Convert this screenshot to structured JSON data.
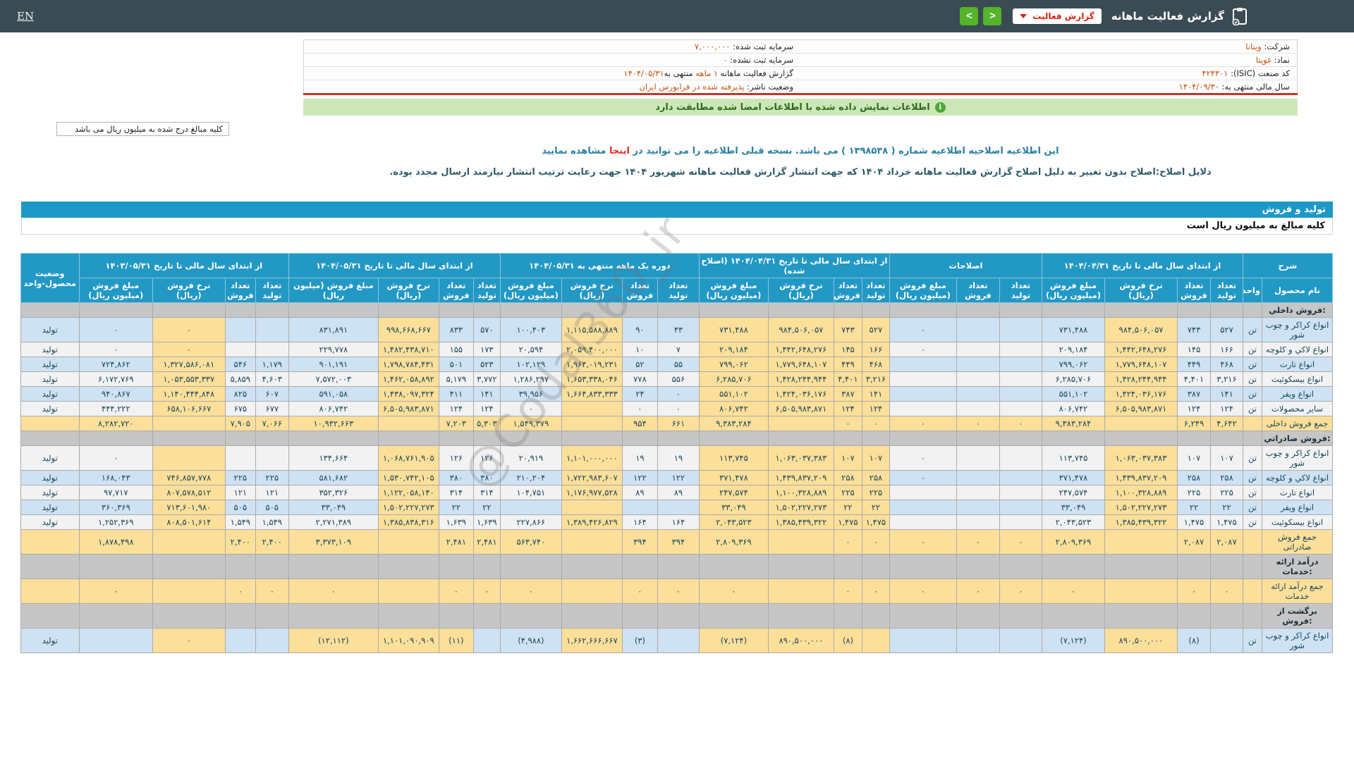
{
  "navbar": {
    "en_label": "EN",
    "title": "گزارش فعالیت ماهانه",
    "dropdown_label": "گزارش فعالیت",
    "back_glyph": "<",
    "forward_glyph": ">"
  },
  "info": {
    "rows": [
      {
        "right": {
          "label": "شرکت:",
          "value": "ویتانا"
        },
        "left": {
          "label": "سرمایه ثبت شده:",
          "value": "۷,۰۰۰,۰۰۰"
        }
      },
      {
        "right": {
          "label": "نماد:",
          "value": "غویتا"
        },
        "left": {
          "label": "سرمایه ثبت نشده:",
          "value": "۰"
        }
      },
      {
        "right": {
          "label": "کد صنعت (ISIC):",
          "value": "۴۲۴۳۰۱"
        },
        "left": {
          "label": "گزارش فعالیت ماهانه",
          "value": "۱ ماهه",
          "label2": "منتهی به",
          "value2": "۱۴۰۴/۰۵/۳۱"
        }
      },
      {
        "right": {
          "label": "سال مالی منتهی به:",
          "value": "۱۴۰۴/۰۹/۳۰"
        },
        "left": {
          "label": "وضعیت ناشر:",
          "value": "پذیرفته شده در فرابورس ایران"
        }
      }
    ]
  },
  "notice": "اطلاعات نمایش داده شده با اطلاعات امضا شده مطابقت دارد",
  "unit_note": "کلیه مبالغ درج شده به میلیون ریال می باشد",
  "amendment": {
    "line1_prefix": "این اطلاعیه اصلاحیه اطلاعیه شماره ( ۱۳۹۸۵۳۸ ) می باشد. نسخه قبلی اطلاعیه را می توانید در ",
    "line1_link": "اینجا",
    "line1_suffix": " مشاهده نمایید",
    "line2": "دلایل اصلاح:اصلاح بدون تغییر به دلیل اصلاح گزارش فعالیت ماهانه خرداد ۱۴۰۴ که جهت انتشار گزارش فعالیت ماهانه شهریور ۱۴۰۴ جهت رعایت ترتیب انتشار نیازمند ارسال مجدد بوده."
  },
  "section_title": "تولید و فروش",
  "table_note": "کلیه مبالغ به میلیون ریال است",
  "watermark": "@Codal360_ir",
  "table": {
    "groups": [
      {
        "title": "شرح",
        "cols": [
          "نام محصول",
          "واحد"
        ]
      },
      {
        "title": "از ابتدای سال مالی تا تاریخ ۱۴۰۴/۰۴/۳۱",
        "cols": [
          "تعداد تولید",
          "تعداد فروش",
          "نرخ فروش (ریال)",
          "مبلغ فروش (میلیون ریال)"
        ]
      },
      {
        "title": "اصلاحات",
        "cols": [
          "تعداد تولید",
          "تعداد فروش",
          "مبلغ فروش (میلیون ریال)"
        ]
      },
      {
        "title": "از ابتدای سال مالی تا تاریخ ۱۴۰۴/۰۴/۳۱ (اصلاح شده)",
        "cols": [
          "تعداد تولید",
          "تعداد فروش",
          "نرخ فروش (ریال)",
          "مبلغ فروش (میلیون ریال)"
        ]
      },
      {
        "title": "دوره یک ماهه منتهی به ۱۴۰۴/۰۵/۳۱",
        "cols": [
          "تعداد تولید",
          "تعداد فروش",
          "نرخ فروش (ریال)",
          "مبلغ فروش (میلیون ریال)"
        ]
      },
      {
        "title": "از ابتدای سال مالی تا تاریخ ۱۴۰۴/۰۵/۳۱",
        "cols": [
          "تعداد تولید",
          "تعداد فروش",
          "نرخ فروش (ریال)",
          "مبلغ فروش (میلیون ریال)"
        ]
      },
      {
        "title": "از ابتدای سال مالی تا تاریخ ۱۴۰۳/۰۵/۳۱",
        "cols": [
          "تعداد تولید",
          "تعداد فروش",
          "نرخ فروش (ریال)",
          "مبلغ فروش (میلیون ریال)"
        ]
      },
      {
        "title": "وضعیت محصول-واحد",
        "cols": []
      }
    ],
    "rows": [
      {
        "type": "section",
        "cells": [
          "فروش داخلي:",
          "",
          "",
          "",
          "",
          "",
          "",
          "",
          "",
          "",
          "",
          "",
          "",
          "",
          "",
          "",
          "",
          "",
          "",
          "",
          "",
          "",
          "",
          "",
          "",
          ""
        ]
      },
      {
        "type": "data",
        "shade": "b",
        "cells": [
          "انواع کراکر و چوب شور",
          "تن",
          "۵۲۷",
          "۷۴۳",
          "۹۸۴,۵۰۶,۰۵۷",
          "۷۳۱,۴۸۸",
          "",
          "",
          "۰",
          "۵۲۷",
          "۷۴۳",
          "۹۸۴,۵۰۶,۰۵۷",
          "۷۳۱,۴۸۸",
          "۴۳",
          "۹۰",
          "۱,۱۱۵,۵۸۸,۸۸۹",
          "۱۰۰,۴۰۳",
          "۵۷۰",
          "۸۳۳",
          "۹۹۸,۶۶۸,۶۶۷",
          "۸۳۱,۸۹۱",
          "",
          "",
          "۰",
          "۰",
          "تولید"
        ]
      },
      {
        "type": "data",
        "shade": "w",
        "cells": [
          "انواع لاکي و کلوچه",
          "تن",
          "۱۶۶",
          "۱۴۵",
          "۱,۴۴۲,۶۴۸,۲۷۶",
          "۲۰۹,۱۸۴",
          "",
          "",
          "۰",
          "۱۶۶",
          "۱۴۵",
          "۱,۴۴۲,۶۴۸,۲۷۶",
          "۲۰۹,۱۸۴",
          "۷",
          "۱۰",
          "۲,۰۵۹,۴۰۰,۰۰۰",
          "۲۰,۵۹۴",
          "۱۷۳",
          "۱۵۵",
          "۱,۴۸۲,۴۳۸,۷۱۰",
          "۲۲۹,۷۷۸",
          "",
          "",
          "۰",
          "۰",
          "تولید"
        ]
      },
      {
        "type": "data",
        "shade": "b",
        "cells": [
          "انواع تارت",
          "تن",
          "۴۶۸",
          "۴۴۹",
          "۱,۷۷۹,۶۴۸,۱۰۷",
          "۷۹۹,۰۶۲",
          "",
          "",
          "",
          "۴۶۸",
          "۴۴۹",
          "۱,۷۷۹,۶۴۸,۱۰۷",
          "۷۹۹,۰۶۲",
          "۵۵",
          "۵۲",
          "۱,۹۶۴,۰۱۹,۲۳۱",
          "۱۰۲,۱۲۹",
          "۵۲۳",
          "۵۰۱",
          "۱,۷۹۸,۷۸۴,۴۳۱",
          "۹۰۱,۱۹۱",
          "۱,۱۷۹",
          "۵۴۶",
          "۱,۳۲۷,۵۸۶,۰۸۱",
          "۷۲۴,۸۶۲",
          "تولید"
        ]
      },
      {
        "type": "data",
        "shade": "w",
        "cells": [
          "انواع بیسکوئیت",
          "تن",
          "۳,۲۱۶",
          "۴,۴۰۱",
          "۱,۴۲۸,۲۴۴,۹۴۴",
          "۶,۲۸۵,۷۰۶",
          "",
          "",
          "",
          "۳,۲۱۶",
          "۴,۴۰۱",
          "۱,۴۲۸,۲۴۴,۹۴۴",
          "۶,۲۸۵,۷۰۶",
          "۵۵۶",
          "۷۷۸",
          "۱,۶۵۳,۳۳۸,۰۴۶",
          "۱,۲۸۶,۲۹۷",
          "۳,۷۷۲",
          "۵,۱۷۹",
          "۱,۴۶۲,۰۵۸,۸۹۲",
          "۷,۵۷۲,۰۰۳",
          "۴,۶۰۳",
          "۵,۸۵۹",
          "۱,۰۵۳,۵۵۳,۳۳۷",
          "۶,۱۷۲,۷۶۹",
          "تولید"
        ]
      },
      {
        "type": "data",
        "shade": "b",
        "cells": [
          "انواع ویفر",
          "تن",
          "۱۴۱",
          "۳۸۷",
          "۱,۴۲۴,۰۳۶,۱۷۶",
          "۵۵۱,۱۰۲",
          "",
          "",
          "",
          "۱۴۱",
          "۳۸۷",
          "۱,۴۲۴,۰۳۶,۱۷۶",
          "۵۵۱,۱۰۲",
          "۰",
          "۲۴",
          "۱,۶۶۴,۸۳۳,۳۳۳",
          "۳۹,۹۵۶",
          "۱۴۱",
          "۴۱۱",
          "۱,۴۳۸,۰۹۷,۳۲۴",
          "۵۹۱,۰۵۸",
          "۶۰۷",
          "۸۲۵",
          "۱,۱۴۰,۴۴۴,۸۴۸",
          "۹۴۰,۸۶۷",
          "تولید"
        ]
      },
      {
        "type": "data",
        "shade": "w",
        "cells": [
          "سایر محصولات",
          "تن",
          "۱۲۴",
          "۱۲۴",
          "۶,۵۰۵,۹۸۳,۸۷۱",
          "۸۰۶,۷۴۲",
          "",
          "",
          "",
          "۱۲۴",
          "۱۲۴",
          "۶,۵۰۵,۹۸۳,۸۷۱",
          "۸۰۶,۷۴۲",
          "۰",
          "۰",
          "",
          "۰",
          "۱۲۴",
          "۱۲۴",
          "۶,۵۰۵,۹۸۳,۸۷۱",
          "۸۰۶,۷۴۲",
          "۶۷۷",
          "۶۷۵",
          "۶۵۸,۱۰۶,۶۶۷",
          "۴۴۴,۲۲۲",
          "تولید"
        ]
      },
      {
        "type": "total",
        "cells": [
          "جمع فروش داخلی",
          "",
          "۴,۶۴۲",
          "۶,۲۴۹",
          "",
          "۹,۳۸۳,۲۸۴",
          "۰",
          "۰",
          "۰",
          "۰",
          "۰",
          "",
          "۹,۳۸۳,۲۸۴",
          "۶۶۱",
          "۹۵۴",
          "",
          "۱,۵۴۹,۳۷۹",
          "۵,۳۰۳",
          "۷,۲۰۳",
          "",
          "۱۰,۹۳۲,۶۶۳",
          "۷,۰۶۶",
          "۷,۹۰۵",
          "",
          "۸,۲۸۲,۷۲۰",
          ""
        ]
      },
      {
        "type": "section",
        "cells": [
          "فروش صادراتي:",
          "",
          "",
          "",
          "",
          "",
          "",
          "",
          "",
          "",
          "",
          "",
          "",
          "",
          "",
          "",
          "",
          "",
          "",
          "",
          "",
          "",
          "",
          "",
          "",
          ""
        ]
      },
      {
        "type": "data",
        "shade": "w",
        "cells": [
          "انواع کراکر و چوب شور",
          "تن",
          "۱۰۷",
          "۱۰۷",
          "۱,۰۶۳,۰۳۷,۳۸۳",
          "۱۱۳,۷۴۵",
          "",
          "",
          "۰",
          "۱۰۷",
          "۱۰۷",
          "۱,۰۶۳,۰۳۷,۳۸۳",
          "۱۱۳,۷۴۵",
          "۱۹",
          "۱۹",
          "۱,۱۰۱,۰۰۰,۰۰۰",
          "۲۰,۹۱۹",
          "۱۲۶",
          "۱۲۶",
          "۱,۰۶۸,۷۶۱,۹۰۵",
          "۱۳۴,۶۶۴",
          "",
          "",
          "",
          "۰",
          "تولید"
        ]
      },
      {
        "type": "data",
        "shade": "b",
        "cells": [
          "انواع لاکي و کلوچه",
          "تن",
          "۲۵۸",
          "۲۵۸",
          "۱,۴۳۹,۸۳۷,۲۰۹",
          "۳۷۱,۴۷۸",
          "",
          "",
          "۰",
          "۲۵۸",
          "۲۵۸",
          "۱,۴۳۹,۸۳۷,۲۰۹",
          "۳۷۱,۴۷۸",
          "۱۲۲",
          "۱۲۲",
          "۱,۷۲۲,۹۸۳,۶۰۷",
          "۲۱۰,۲۰۴",
          "۳۸۰",
          "۳۸۰",
          "۱,۵۳۰,۷۴۲,۱۰۵",
          "۵۸۱,۶۸۲",
          "۲۲۵",
          "۲۲۵",
          "۷۴۶,۸۵۷,۷۷۸",
          "۱۶۸,۰۴۳",
          "تولید"
        ]
      },
      {
        "type": "data",
        "shade": "w",
        "cells": [
          "انواع تارت",
          "تن",
          "۲۲۵",
          "۲۲۵",
          "۱,۱۰۰,۳۲۸,۸۸۹",
          "۲۴۷,۵۷۴",
          "",
          "",
          "",
          "۲۲۵",
          "۲۲۵",
          "۱,۱۰۰,۳۲۸,۸۸۹",
          "۲۴۷,۵۷۴",
          "۸۹",
          "۸۹",
          "۱,۱۷۶,۹۷۷,۵۲۸",
          "۱۰۴,۷۵۱",
          "۳۱۴",
          "۳۱۴",
          "۱,۱۲۲,۰۵۸,۱۴۰",
          "۳۵۲,۳۲۶",
          "۱۲۱",
          "۱۲۱",
          "۸۰۷,۵۷۸,۵۱۲",
          "۹۷,۷۱۷",
          "تولید"
        ]
      },
      {
        "type": "data",
        "shade": "b",
        "cells": [
          "انواع ویفر",
          "تن",
          "۲۲",
          "۲۲",
          "۱,۵۰۲,۲۲۷,۲۷۳",
          "۳۳,۰۴۹",
          "",
          "",
          "",
          "۲۲",
          "۲۲",
          "۱,۵۰۲,۲۲۷,۲۷۳",
          "۳۳,۰۴۹",
          "",
          "",
          "",
          "",
          "۲۲",
          "۲۲",
          "۱,۵۰۲,۲۲۷,۲۷۳",
          "۳۳,۰۴۹",
          "۵۰۵",
          "۵۰۵",
          "۷۱۳,۶۰۱,۹۸۰",
          "۳۶۰,۳۶۹",
          "تولید"
        ]
      },
      {
        "type": "data",
        "shade": "w",
        "cells": [
          "انواع بیسکوئیت",
          "تن",
          "۱,۴۷۵",
          "۱,۴۷۵",
          "۱,۳۸۵,۴۳۹,۳۲۲",
          "۲,۰۴۳,۵۲۳",
          "",
          "",
          "",
          "۱,۴۷۵",
          "۱,۴۷۵",
          "۱,۳۸۵,۴۳۹,۳۲۲",
          "۲,۰۴۳,۵۲۳",
          "۱۶۴",
          "۱۶۴",
          "۱,۳۸۹,۴۲۶,۸۲۹",
          "۲۲۷,۸۶۶",
          "۱,۶۳۹",
          "۱,۶۳۹",
          "۱,۳۸۵,۸۳۸,۳۱۶",
          "۲,۲۷۱,۳۸۹",
          "۱,۵۴۹",
          "۱,۵۴۹",
          "۸۰۸,۵۰۱,۶۱۴",
          "۱,۲۵۲,۳۶۹",
          "تولید"
        ]
      },
      {
        "type": "total",
        "cells": [
          "جمع فروش صادراتی",
          "",
          "۲,۰۸۷",
          "۲,۰۸۷",
          "",
          "۲,۸۰۹,۳۶۹",
          "۰",
          "۰",
          "۰",
          "۰",
          "۰",
          "",
          "۲,۸۰۹,۳۶۹",
          "۳۹۴",
          "۳۹۴",
          "",
          "۵۶۳,۷۴۰",
          "۲,۴۸۱",
          "۲,۴۸۱",
          "",
          "۳,۳۷۳,۱۰۹",
          "۲,۴۰۰",
          "۲,۴۰۰",
          "",
          "۱,۸۷۸,۴۹۸",
          ""
        ]
      },
      {
        "type": "section",
        "cells": [
          "درآمد ارائه خدمات:",
          "",
          "",
          "",
          "",
          "",
          "",
          "",
          "",
          "",
          "",
          "",
          "",
          "",
          "",
          "",
          "",
          "",
          "",
          "",
          "",
          "",
          "",
          "",
          "",
          ""
        ]
      },
      {
        "type": "total",
        "cells": [
          "جمع درآمد ارائه خدمات",
          "",
          "۰",
          "۰",
          "",
          "۰",
          "۰",
          "۰",
          "۰",
          "۰",
          "۰",
          "",
          "۰",
          "۰",
          "۰",
          "",
          "۰",
          "۰",
          "۰",
          "",
          "۰",
          "۰",
          "۰",
          "",
          "۰",
          ""
        ]
      },
      {
        "type": "section",
        "cells": [
          "برگشت از فروش:",
          "",
          "",
          "",
          "",
          "",
          "",
          "",
          "",
          "",
          "",
          "",
          "",
          "",
          "",
          "",
          "",
          "",
          "",
          "",
          "",
          "",
          "",
          "",
          "",
          ""
        ]
      },
      {
        "type": "data",
        "shade": "b",
        "neg": [
          3,
          5,
          10,
          12,
          14,
          16,
          18,
          20
        ],
        "yl": [
          18,
          20
        ],
        "cells": [
          "انواع کراکر و چوب شور",
          "تن",
          "",
          "(۸)",
          "۸۹۰,۵۰۰,۰۰۰",
          "(۷,۱۲۴)",
          "",
          "",
          "",
          "",
          "(۸)",
          "۸۹۰,۵۰۰,۰۰۰",
          "(۷,۱۲۴)",
          "",
          "(۳)",
          "۱,۶۶۲,۶۶۶,۶۶۷",
          "(۴,۹۸۸)",
          "",
          "(۱۱)",
          "۱,۱۰۱,۰۹۰,۹۰۹",
          "(۱۲,۱۱۲)",
          "",
          "",
          "۰",
          "",
          "تولید"
        ]
      }
    ]
  }
}
